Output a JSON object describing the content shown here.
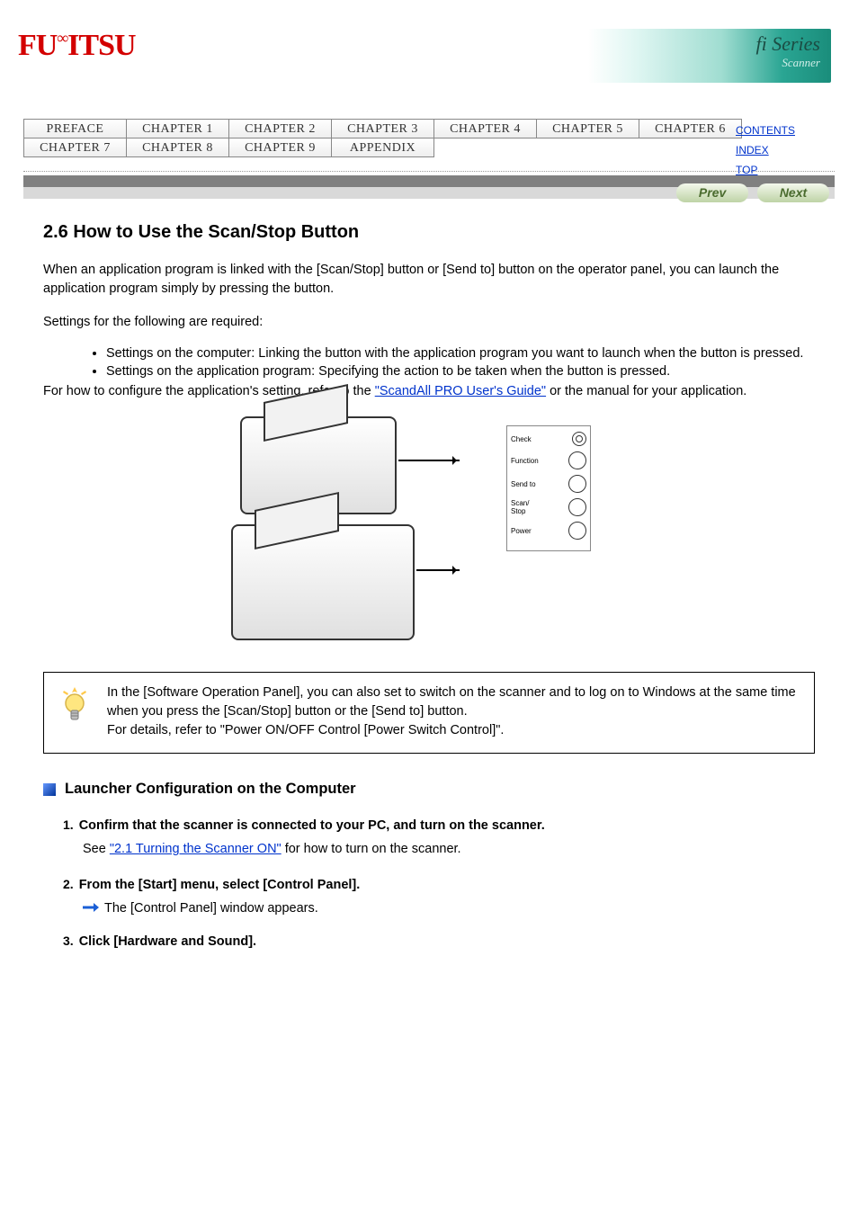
{
  "header": {
    "logo": "FUJITSU",
    "banner_main": "fi Series",
    "banner_sub": "Scanner"
  },
  "tabs": [
    "PREFACE",
    "CHAPTER 1",
    "CHAPTER 2",
    "CHAPTER 3",
    "CHAPTER 4",
    "CHAPTER 5",
    "CHAPTER 6",
    "CHAPTER 7",
    "CHAPTER 8",
    "CHAPTER 9",
    "APPENDIX"
  ],
  "sidelinks": {
    "contents": "CONTENTS",
    "index": "INDEX",
    "top": "TOP"
  },
  "prevnext": {
    "prev": "Prev",
    "next": "Next"
  },
  "main": {
    "h1": "2.6 How to Use the Scan/Stop Button",
    "lead": "When an application program is linked with the [Scan/Stop] button or [Send to] button on the operator panel, you can launch the application program simply by pressing the button.",
    "settings_intro": "Settings for the following are required:",
    "settings": [
      "Settings on the computer: Linking the button with the application program you want to launch when the button is pressed.",
      "Settings on the application program: Specifying the action to be taken when the button is pressed."
    ],
    "ref_line_pre": "For how to configure the application's setting, refer to the ",
    "ref_link": "\"ScandAll PRO User's Guide\"",
    "ref_line_post": " or the manual for your application.",
    "panel_labels": [
      "Check",
      "Function",
      "Send to",
      "Scan/\nStop",
      "Power"
    ],
    "tip1": "In the [Software Operation Panel], you can also set to switch on the scanner and to log on to Windows at the same time when you press the [Scan/Stop] button or the [Send to] button.",
    "tip2_pre": "For details, refer to ",
    "tip2_link": "\"Power ON/OFF Control [Power Switch Control]\"",
    "tip2_post": ".",
    "subhead": "Launcher Configuration on the Computer",
    "steps": [
      {
        "title": "Confirm that the scanner is connected to your PC, and turn on the scanner.",
        "desc_pre": "See ",
        "desc_link": "\"2.1 Turning the Scanner ON\"",
        "desc_post": " for how to turn on the scanner."
      },
      {
        "title": "From the [Start] menu, select [Control Panel].",
        "result": "The [Control Panel] window appears."
      },
      {
        "title": "Click [Hardware and Sound]."
      }
    ]
  }
}
